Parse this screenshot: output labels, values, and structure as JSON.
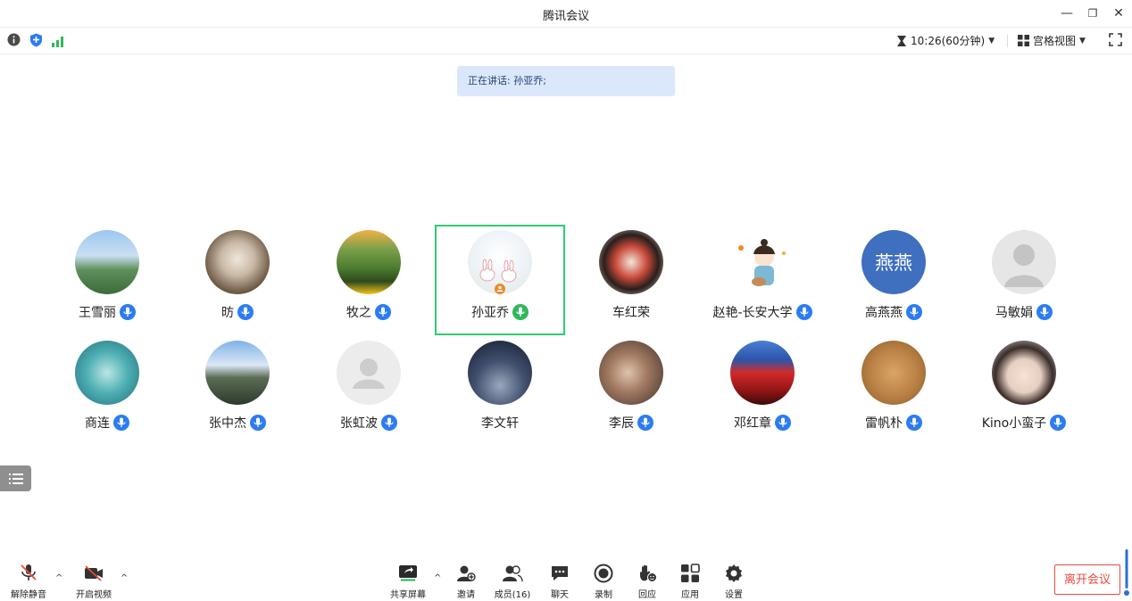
{
  "window": {
    "title": "腾讯会议"
  },
  "toolbar": {
    "timer": "10:26(60分钟)",
    "view_label": "宫格视图"
  },
  "speaking_banner": "正在讲话: 孙亚乔;",
  "participants": [
    {
      "name": "王雪丽",
      "mic": "blue"
    },
    {
      "name": "昉",
      "mic": "blue"
    },
    {
      "name": "牧之",
      "mic": "blue"
    },
    {
      "name": "孙亚乔",
      "mic": "green",
      "active": true
    },
    {
      "name": "车红荣",
      "mic": "none"
    },
    {
      "name": "赵艳-长安大学",
      "mic": "blue"
    },
    {
      "name": "高燕燕",
      "mic": "blue",
      "avatar_text": "燕燕"
    },
    {
      "name": "马敏娟",
      "mic": "blue"
    },
    {
      "name": "商连",
      "mic": "blue"
    },
    {
      "name": "张中杰",
      "mic": "blue"
    },
    {
      "name": "张虹波",
      "mic": "blue"
    },
    {
      "name": "李文轩",
      "mic": "none"
    },
    {
      "name": "李辰",
      "mic": "blue"
    },
    {
      "name": "邓红章",
      "mic": "blue"
    },
    {
      "name": "雷帆朴",
      "mic": "blue"
    },
    {
      "name": "Kino小蛮子",
      "mic": "blue"
    }
  ],
  "controls": {
    "unmute": "解除静音",
    "start_video": "开启视频",
    "share_screen": "共享屏幕",
    "invite": "邀请",
    "members": "成员(16)",
    "chat": "聊天",
    "record": "录制",
    "react": "回应",
    "apps": "应用",
    "settings": "设置",
    "leave": "离开会议"
  },
  "colors": {
    "accent": "#2b7cf2",
    "speaking_bg": "#dbe8fb",
    "active_border": "#2ecc71",
    "leave": "#e8493f"
  }
}
